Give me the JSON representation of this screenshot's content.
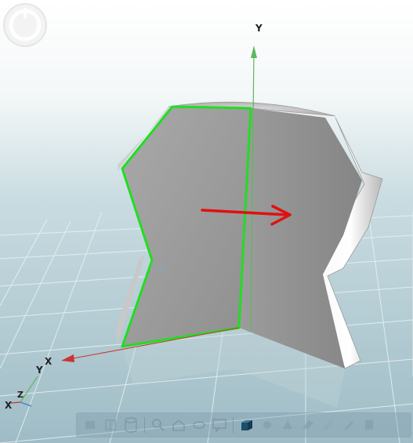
{
  "axes": {
    "main_y_label": "Y",
    "main_z_label": "Z",
    "main_x_label": "X"
  },
  "triad": {
    "x_label": "X",
    "y_label": "Y",
    "z_label": "Z"
  },
  "colors": {
    "edge_highlight": "#22dd22",
    "direction_arrow": "#e01010",
    "y_axis": "#5cb85c",
    "x_axis": "#cc3333",
    "z_axis": "#8fb8d0",
    "face_left": "#9a9a9a",
    "face_right": "#8a8a8a"
  },
  "toolbar": {
    "buttons": [
      {
        "icon": "layers-icon"
      },
      {
        "icon": "split-icon"
      },
      {
        "icon": "cylinder-icon"
      },
      {
        "icon": "zoom-icon"
      },
      {
        "icon": "home-icon"
      },
      {
        "icon": "orbit-icon"
      },
      {
        "icon": "comment-icon"
      },
      {
        "icon": "solid-box-icon",
        "active": true
      },
      {
        "icon": "measure-icon"
      },
      {
        "icon": "explode-icon"
      },
      {
        "icon": "section-icon"
      },
      {
        "icon": "markup-icon"
      },
      {
        "icon": "pen-icon"
      },
      {
        "icon": "settings-icon"
      }
    ]
  }
}
